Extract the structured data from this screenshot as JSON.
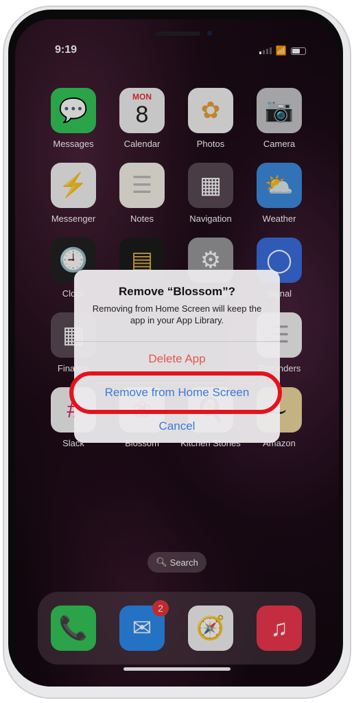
{
  "status": {
    "time": "9:19"
  },
  "apps": [
    {
      "label": "Messages",
      "icon": "messages-icon",
      "glyph": "💬",
      "bg": "#34c759"
    },
    {
      "label": "Calendar",
      "icon": "calendar-icon",
      "glyph": "",
      "bg": "#f2f2f2",
      "day": "MON",
      "date": "8"
    },
    {
      "label": "Photos",
      "icon": "photos-icon",
      "glyph": "✿",
      "bg": "#f4f4f4",
      "fg": "#e8a23a"
    },
    {
      "label": "Camera",
      "icon": "camera-icon",
      "glyph": "📷",
      "bg": "#c9c9cc"
    },
    {
      "label": "Messenger",
      "icon": "messenger-icon",
      "glyph": "⚡",
      "bg": "#f4f4f6",
      "fg": "#8a3ef0"
    },
    {
      "label": "Notes",
      "icon": "notes-icon",
      "glyph": "☰",
      "bg": "#f6f3e8",
      "fg": "#bbb"
    },
    {
      "label": "Navigation",
      "icon": "folder-icon",
      "glyph": "▦",
      "bg": "#5a4a55"
    },
    {
      "label": "Weather",
      "icon": "weather-icon",
      "glyph": "⛅",
      "bg": "#3d8be0"
    },
    {
      "label": "Clock",
      "icon": "clock-icon",
      "glyph": "🕘",
      "bg": "#222",
      "fg": "#fff"
    },
    {
      "label": "Wallet",
      "icon": "wallet-icon",
      "glyph": "▤",
      "bg": "#1c1c1c",
      "fg": "#e0b040"
    },
    {
      "label": "Settings",
      "icon": "settings-icon",
      "glyph": "⚙",
      "bg": "#9a9a9e"
    },
    {
      "label": "Signal",
      "icon": "signal-icon",
      "glyph": "◯",
      "bg": "#3a6ee0"
    },
    {
      "label": "Finance",
      "icon": "folder-icon",
      "glyph": "▦",
      "bg": "#5a4a55"
    },
    {
      "label": "",
      "icon": "blank-icon",
      "glyph": "",
      "bg": "transparent"
    },
    {
      "label": "",
      "icon": "blank-icon",
      "glyph": "",
      "bg": "transparent"
    },
    {
      "label": "Reminders",
      "icon": "reminders-icon",
      "glyph": "☰",
      "bg": "#f4f4f4",
      "fg": "#aaa"
    },
    {
      "label": "Slack",
      "icon": "slack-icon",
      "glyph": "#",
      "bg": "#f4f4f4",
      "fg": "#e01e5a"
    },
    {
      "label": "Blossom",
      "icon": "blossom-icon",
      "glyph": "❀",
      "bg": "#e8e0e6",
      "fg": "#c06"
    },
    {
      "label": "Kitchen Stories",
      "icon": "kitchen-stories-icon",
      "glyph": "🍳",
      "bg": "#e8e8e8"
    },
    {
      "label": "Amazon",
      "icon": "amazon-icon",
      "glyph": "⌣",
      "bg": "#f1d9a0",
      "fg": "#222"
    }
  ],
  "search": {
    "label": "Search"
  },
  "dock": [
    {
      "icon": "phone-icon",
      "glyph": "📞",
      "bg": "#34c759"
    },
    {
      "icon": "mail-icon",
      "glyph": "✉",
      "bg": "#2d8cf0",
      "badge": "2"
    },
    {
      "icon": "safari-icon",
      "glyph": "🧭",
      "bg": "#f4f4f6"
    },
    {
      "icon": "music-icon",
      "glyph": "♫",
      "bg": "#f0384f"
    }
  ],
  "dialog": {
    "title": "Remove “Blossom”?",
    "message": "Removing from Home Screen will keep the app in your App Library.",
    "delete": "Delete App",
    "remove": "Remove from Home Screen",
    "cancel": "Cancel"
  },
  "colors": {
    "destructive": "#e2564f",
    "action": "#3a7ad9",
    "highlight": "#e3131d"
  }
}
